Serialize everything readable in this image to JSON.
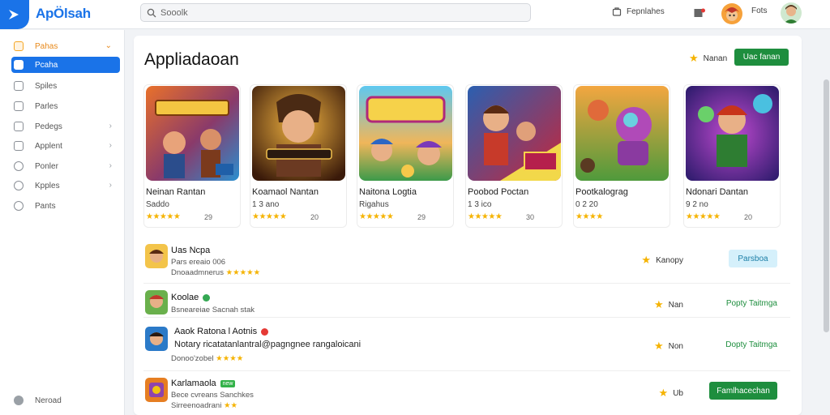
{
  "app": {
    "logo_text": "ApÖlsah"
  },
  "search": {
    "placeholder": "Sooolk"
  },
  "topbar": {
    "item1": "Fepnlahes",
    "item2": "Fots"
  },
  "sidebar": {
    "items": [
      {
        "label": "Pahas",
        "icon": "app-icon"
      },
      {
        "label": "Pcaha",
        "icon": "home-icon"
      },
      {
        "label": "Spiles",
        "icon": "grid-icon"
      },
      {
        "label": "Parles",
        "icon": "folder-icon"
      },
      {
        "label": "Pedegs",
        "icon": "tag-icon"
      },
      {
        "label": "Applent",
        "icon": "apps-icon"
      },
      {
        "label": "Ponler",
        "icon": "chat-icon"
      },
      {
        "label": "Kpples",
        "icon": "pin-icon"
      },
      {
        "label": "Pants",
        "icon": "clock-icon"
      }
    ],
    "footer": "Neroad"
  },
  "page": {
    "title": "Appliadaoan",
    "rank_label": "Nanan",
    "rank_button": "Uac fanan"
  },
  "cards": [
    {
      "name": "Neinan Rantan",
      "sub": "Saddo",
      "stars": "★★★★★",
      "rating": "29"
    },
    {
      "name": "Koamaol Nantan",
      "sub": "1 3 ano",
      "stars": "★★★★★",
      "rating": "20"
    },
    {
      "name": "Naitona Logtia",
      "sub": "Rigahus",
      "stars": "★★★★★",
      "rating": "29"
    },
    {
      "name": "Poobod Poctan",
      "sub": "1 3 ico",
      "stars": "★★★★★",
      "rating": "30"
    },
    {
      "name": "Pootkalograg",
      "sub": "0 2 20",
      "stars": "★★★★",
      "rating": ""
    },
    {
      "name": "Ndonari Dantan",
      "sub": "9 2 no",
      "stars": "★★★★★",
      "rating": "20"
    }
  ],
  "list": [
    {
      "title": "Uas Ncpa",
      "line1": "Pars ereaio 006",
      "line2": "Dnoaadmnerus",
      "stars": "★★★★★",
      "right": "Kanopy",
      "action": "Parsboa"
    },
    {
      "title": "Koolae",
      "line1": "Bsneareiae Sacnah stak",
      "line2": "",
      "stars": "",
      "right": "Nan",
      "action": "Popty Taitmga"
    },
    {
      "title": "Aaok Ratona l Aotnis",
      "line1": "Donoo'zobel",
      "line2": "Notary ricatatanlantral@pagngnee rangaloicani",
      "stars": "★★★★",
      "right": "Non",
      "action": "Dopty Taitmga"
    },
    {
      "title": "Karlamaola",
      "line1": "Bece cvreans Sanchkes",
      "line2": "Sirreenoadrani",
      "stars": "★★",
      "right": "Ub",
      "action": "Famlhacechan",
      "tag": "new"
    }
  ],
  "colors": {
    "accent": "#1a73e8",
    "green": "#1e8e3e",
    "star": "#f5b301"
  }
}
